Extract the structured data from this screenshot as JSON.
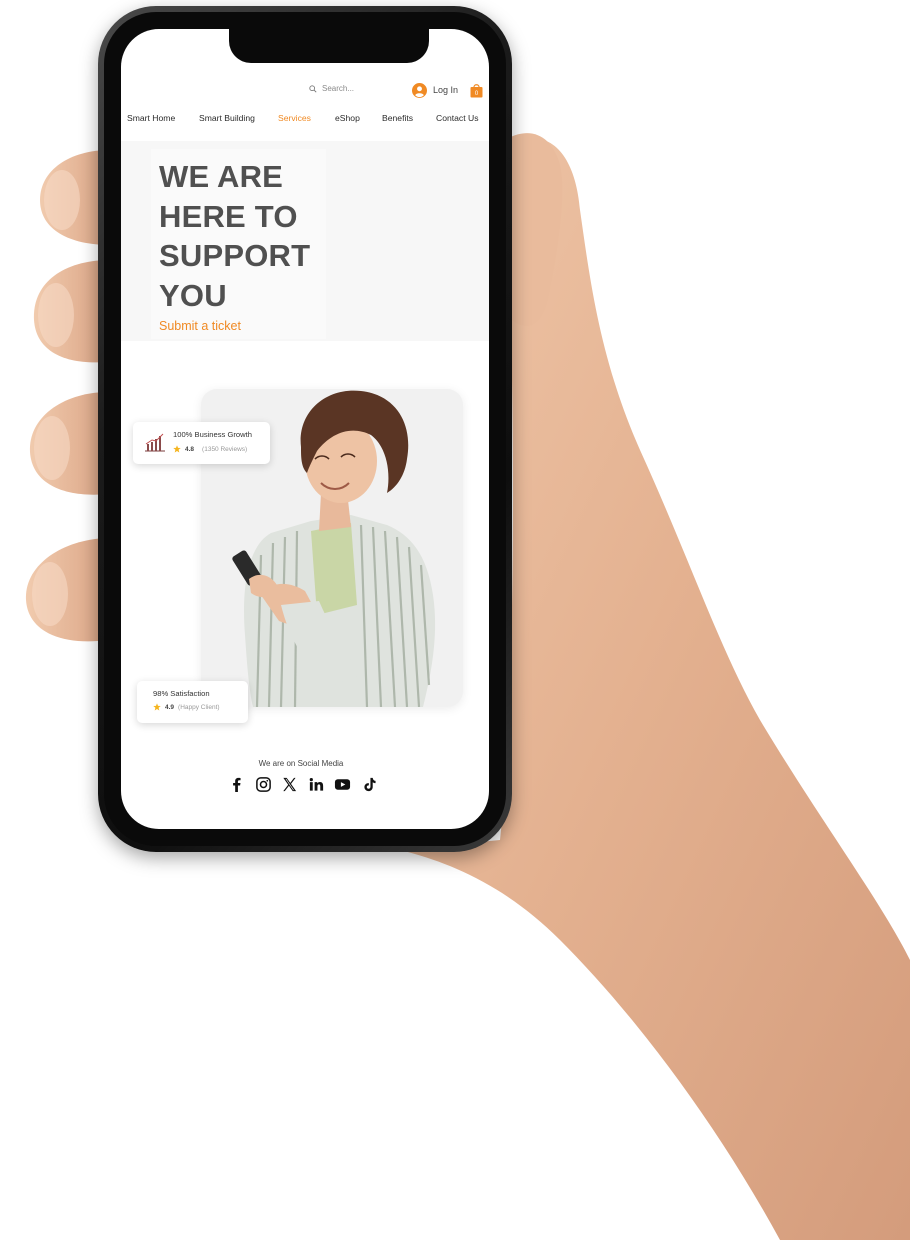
{
  "topbar": {
    "search_placeholder": "Search...",
    "login_label": "Log In",
    "cart_count": "0"
  },
  "nav": {
    "items": [
      {
        "label": "Smart Home"
      },
      {
        "label": "Smart Building"
      },
      {
        "label": "Services",
        "active": true
      },
      {
        "label": "eShop"
      },
      {
        "label": "Benefits"
      },
      {
        "label": "Contact Us"
      }
    ]
  },
  "hero": {
    "title_lines": [
      "WE ARE",
      "HERE TO",
      "SUPPORT",
      "YOU"
    ],
    "cta_label": "Submit a ticket"
  },
  "stats": {
    "growth": {
      "title": "100% Business Growth",
      "rating": "4.8",
      "note": "(1350 Reviews)"
    },
    "satisfaction": {
      "title": "98% Satisfaction",
      "rating": "4.9",
      "note": "(Happy Client)"
    }
  },
  "social": {
    "label": "We are on Social Media",
    "icons": [
      "facebook-icon",
      "instagram-icon",
      "x-icon",
      "linkedin-icon",
      "youtube-icon",
      "tiktok-icon"
    ]
  },
  "colors": {
    "accent": "#f08a24",
    "heading": "#505050",
    "star": "#f5b51f"
  }
}
